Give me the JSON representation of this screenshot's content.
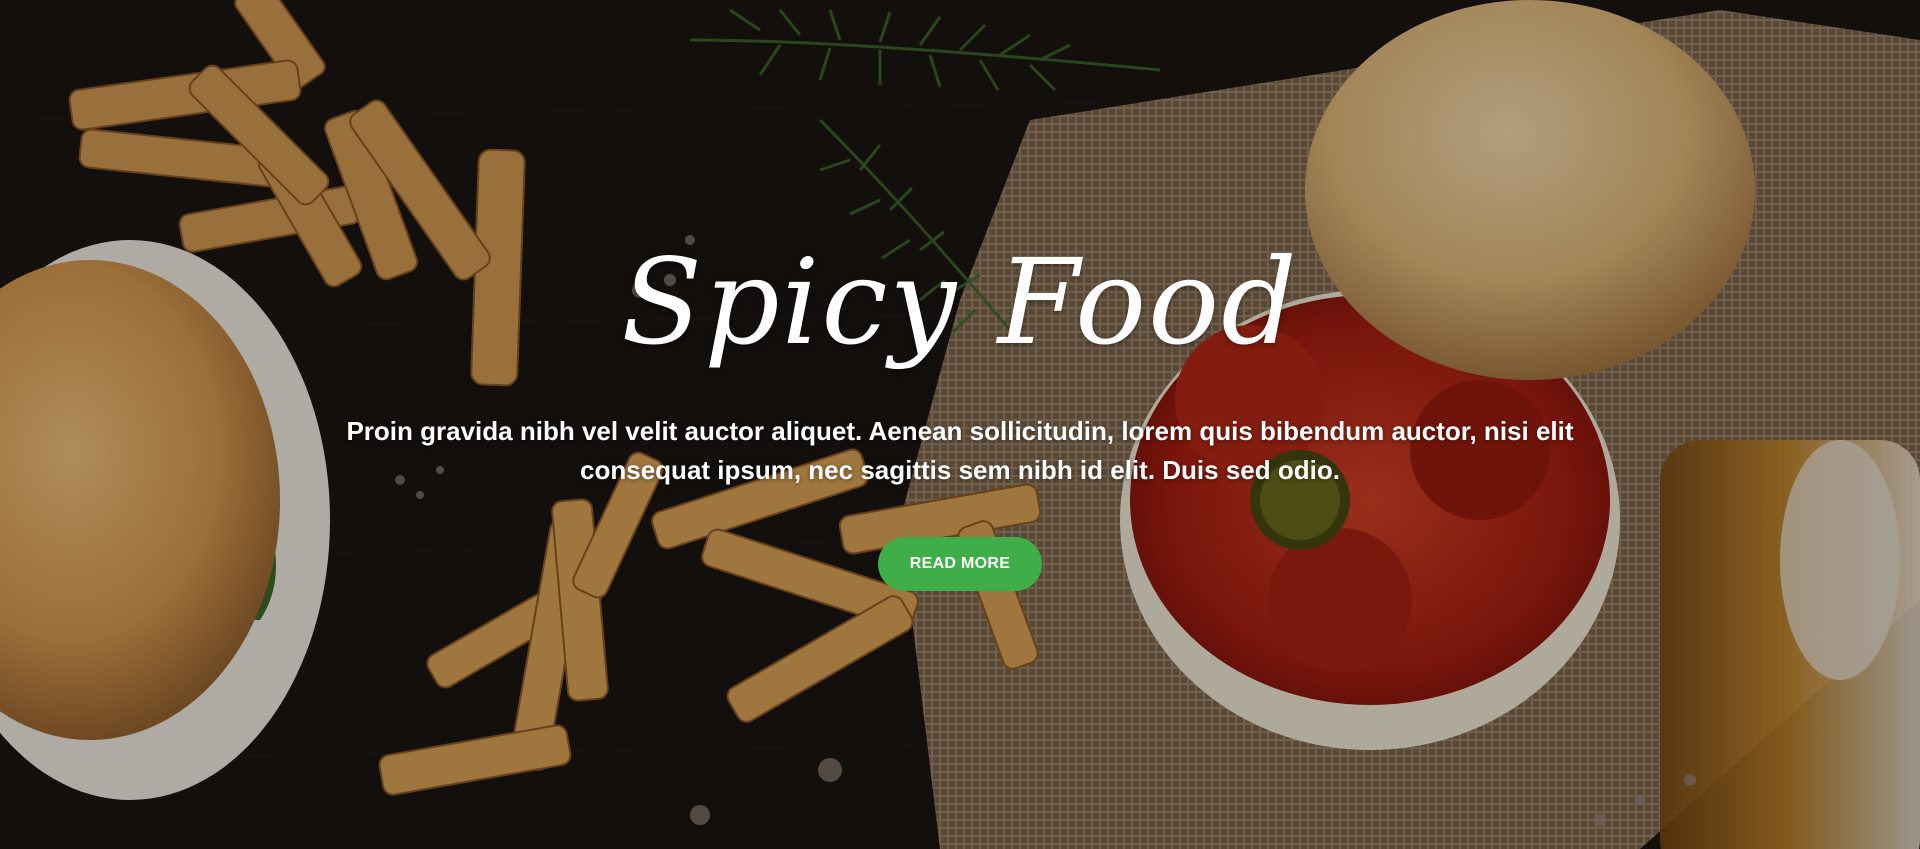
{
  "hero": {
    "title": "Spicy Food",
    "description": "Proin gravida nibh vel velit auctor aliquet. Aenean sollicitudin, lorem quis bibendum auctor, nisi elit consequat ipsum, nec sagittis sem nibh id elit. Duis sed odio.",
    "button_label": "READ MORE",
    "background_image": "burger-and-fries-photo"
  },
  "colors": {
    "button": "#3fae49",
    "text": "#ffffff"
  }
}
